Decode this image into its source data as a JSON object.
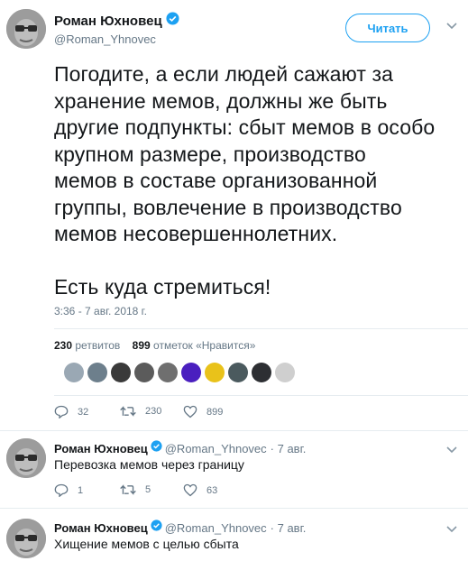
{
  "tweet": {
    "author_name": "Роман Юхновец",
    "author_handle": "@Roman_Yhnovec",
    "follow_label": "Читать",
    "text_lines": [
      "Погодите, а если людей сажают за",
      "хранение мемов, должны же быть",
      "другие подпункты: сбыт мемов в особо",
      "крупном размере, производство",
      "мемов в составе организованной",
      "группы, вовлечение в производство",
      "мемов несовершеннолетних."
    ],
    "text_final": "Есть куда стремиться!",
    "timestamp": "3:36 - 7 авг. 2018 г.",
    "retweets_count": "230",
    "retweets_label": "ретвитов",
    "likes_count": "899",
    "likes_label": "отметок «Нравится»",
    "likers_colors": [
      "#9aa8b4",
      "#6d7f8c",
      "#3a3a3a",
      "#5b5b5b",
      "#6f6f6f",
      "#4a1fbf",
      "#e9c21a",
      "#4b5a5e",
      "#2d2f33",
      "#cfcfcf"
    ],
    "actions": {
      "replies": "32",
      "retweets": "230",
      "likes": "899"
    }
  },
  "replies": [
    {
      "author_name": "Роман Юхновец",
      "author_handle": "@Roman_Yhnovec",
      "date": "· 7 авг.",
      "text": "Перевозка мемов через границу",
      "actions": {
        "replies": "1",
        "retweets": "5",
        "likes": "63"
      }
    },
    {
      "author_name": "Роман Юхновец",
      "author_handle": "@Roman_Yhnovec",
      "date": "· 7 авг.",
      "text": "Хищение мемов с целью сбыта"
    }
  ],
  "icons": {
    "verified": "verified-badge-icon",
    "reply": "reply-icon",
    "retweet": "retweet-icon",
    "like": "heart-icon",
    "more": "chevron-down-icon"
  },
  "colors": {
    "accent": "#1da1f2",
    "muted": "#657786",
    "text": "#14171a",
    "divider": "#e6ecf0"
  }
}
